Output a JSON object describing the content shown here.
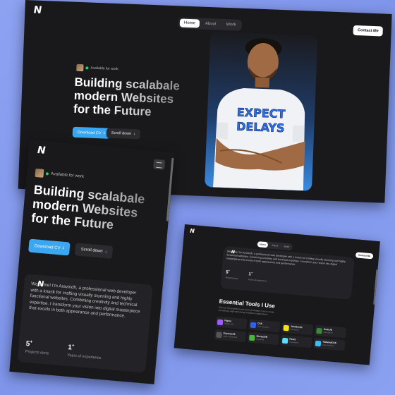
{
  "brand": {
    "logo_glyph": "N"
  },
  "nav": {
    "items": [
      {
        "label": "Home",
        "active": true
      },
      {
        "label": "About",
        "active": false
      },
      {
        "label": "Work",
        "active": false
      }
    ]
  },
  "contact_label": "Contact Me",
  "availability": "Available for work",
  "hero": {
    "headline_line1": "Building scalabale",
    "headline_line2": "modern Websites",
    "headline_line3": "for the Future",
    "download_label": "Download CV",
    "scroll_label": "Scroll down"
  },
  "portrait": {
    "shirt_line1": "EXPECT",
    "shirt_line2": "DELAYS"
  },
  "about": {
    "text": "Welcome! I'm Aravindh, a professional web developer with a knack for crafting visually stunning and highly functional websites. Combining creativity and technical expertise, I transform your vision into digital masterpiece that excels in both appearance and performance.",
    "stats": [
      {
        "value": "5",
        "suffix": "+",
        "label": "Projects done"
      },
      {
        "value": "1",
        "suffix": "+",
        "label": "Years of experience"
      }
    ]
  },
  "tools": {
    "title": "Essential Tools I Use",
    "subtitle": "Discover the powerful tools and technologies I use to create exceptional, high-performing websites & applications.",
    "items": [
      {
        "name": "Figma",
        "desc": "Design tool",
        "color": "#a259ff"
      },
      {
        "name": "CSS",
        "desc": "User Interface",
        "color": "#2965f1"
      },
      {
        "name": "JavaScript",
        "desc": "Interaction",
        "color": "#f7df1e"
      },
      {
        "name": "NodeJS",
        "desc": "Web Server",
        "color": "#3c873a"
      },
      {
        "name": "ExpressJS",
        "desc": "Node Framework",
        "color": "#555555"
      },
      {
        "name": "MongoDB",
        "desc": "Database",
        "color": "#4db33d"
      },
      {
        "name": "React",
        "desc": "Framework",
        "color": "#61dafb"
      },
      {
        "name": "TailwindCSS",
        "desc": "User Interface",
        "color": "#38bdf8"
      }
    ]
  },
  "colors": {
    "accent": "#3aa7f0",
    "background": "#19191c",
    "page_bg": "#8ea2f2"
  }
}
